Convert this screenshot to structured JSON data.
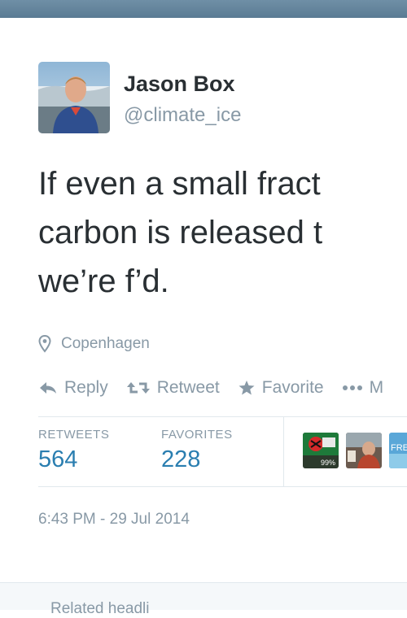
{
  "tweet": {
    "author_name": "Jason Box",
    "author_handle": "@climate_ice",
    "text_lines": [
      "If even a small fract",
      "carbon is released t",
      "we’re f’d."
    ],
    "location": "Copenhagen",
    "timestamp": "6:43 PM - 29 Jul 2014"
  },
  "actions": {
    "reply": "Reply",
    "retweet": "Retweet",
    "favorite": "Favorite",
    "more": "M"
  },
  "stats": {
    "retweets_label": "RETWEETS",
    "retweets_value": "564",
    "favorites_label": "FAVORITES",
    "favorites_value": "228"
  },
  "favoriters": {
    "avatar_1_badge": "99%",
    "avatar_3_text": "FRE"
  },
  "footer": {
    "related_label": "Related headli"
  },
  "colors": {
    "link_blue": "#2a7eb0",
    "muted_gray": "#8899a6",
    "text_dark": "#292f33"
  }
}
